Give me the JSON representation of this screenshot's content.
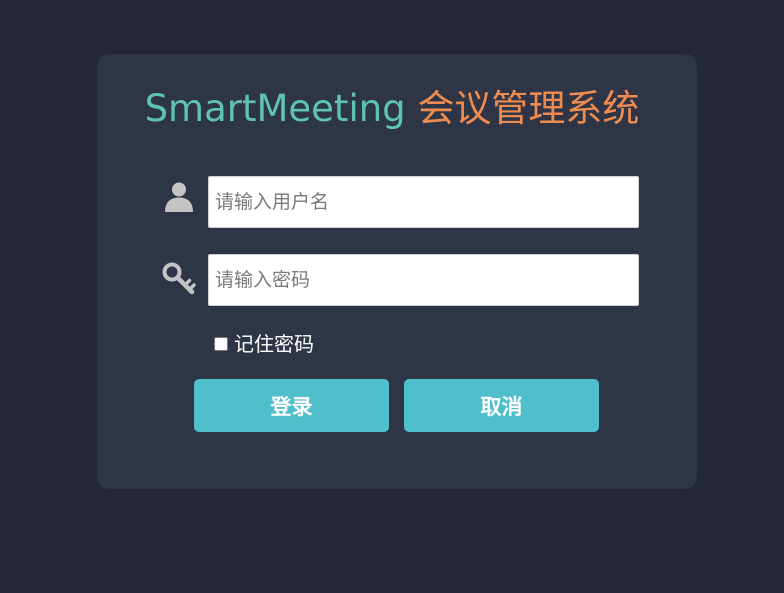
{
  "title": {
    "brand": "SmartMeeting",
    "subtitle": "会议管理系统",
    "brand_color": "#5fc2b6",
    "subtitle_color": "#ef8b4e"
  },
  "form": {
    "username": {
      "icon": "user-icon",
      "value": "",
      "placeholder": "请输入用户名"
    },
    "password": {
      "icon": "key-icon",
      "value": "",
      "placeholder": "请输入密码"
    },
    "remember": {
      "label": "记住密码",
      "checked": false
    }
  },
  "buttons": {
    "login_label": "登录",
    "cancel_label": "取消",
    "color": "#4fbfcc"
  },
  "colors": {
    "background": "#232739",
    "card": "#2d3546"
  }
}
